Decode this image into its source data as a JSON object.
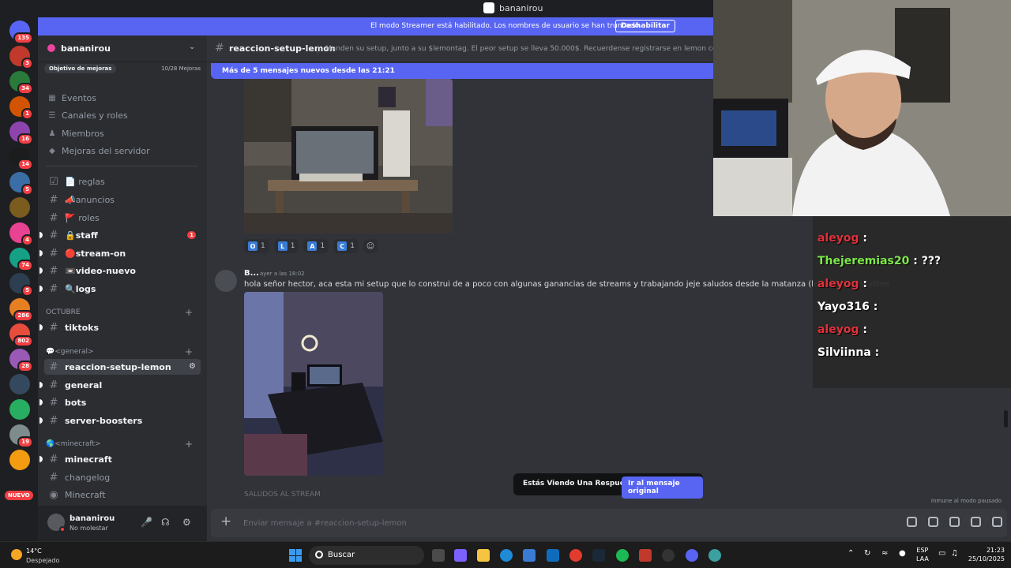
{
  "window": {
    "title": "bananirou"
  },
  "streamer_banner": {
    "text": "El modo Streamer está habilitado. Los nombres de usuario se han truncado.",
    "button": "Deshabilitar"
  },
  "servers": [
    {
      "badge": "135"
    },
    {
      "badge": "3"
    },
    {
      "badge": "34"
    },
    {
      "badge": "1"
    },
    {
      "badge": "16"
    },
    {
      "badge": "14"
    },
    {
      "badge": "5"
    },
    {
      "badge": ""
    },
    {
      "badge": "4"
    },
    {
      "badge": "74"
    },
    {
      "badge": "5"
    },
    {
      "badge": "286"
    },
    {
      "badge": "802"
    },
    {
      "badge": "28"
    },
    {
      "badge": ""
    },
    {
      "badge": ""
    },
    {
      "badge": "19"
    },
    {
      "badge": ""
    }
  ],
  "server_new_badge": "NUEVO",
  "guild": {
    "name": "bananirou",
    "boost_goal": "Objetivo de mejoras",
    "boost_count": "10/28 Mejoras",
    "nav": [
      {
        "label": "Eventos",
        "icon": "calendar-icon"
      },
      {
        "label": "Canales y roles",
        "icon": "channels-icon"
      },
      {
        "label": "Miembros",
        "icon": "members-icon"
      },
      {
        "label": "Mejoras del servidor",
        "icon": "boost-icon"
      }
    ],
    "channels_top": [
      {
        "name": "📄 reglas",
        "unread": false,
        "mention": ""
      },
      {
        "name": "📣anuncios",
        "unread": false,
        "mention": ""
      },
      {
        "name": "🚩 roles",
        "unread": false,
        "mention": ""
      },
      {
        "name": "🔒staff",
        "unread": true,
        "mention": "1"
      },
      {
        "name": "🔴stream-on",
        "unread": true,
        "mention": ""
      },
      {
        "name": "📼video-nuevo",
        "unread": true,
        "mention": ""
      },
      {
        "name": "🔍logs",
        "unread": true,
        "mention": ""
      }
    ],
    "categories": [
      {
        "name": "OCTUBRE",
        "channels": [
          {
            "name": "tiktoks",
            "unread": true
          }
        ]
      },
      {
        "name": "💬<general>",
        "channels": [
          {
            "name": "reaccion-setup-lemon",
            "unread": true,
            "active": true
          },
          {
            "name": "general",
            "unread": true
          },
          {
            "name": "bots",
            "unread": true
          },
          {
            "name": "server-boosters",
            "unread": true
          }
        ]
      },
      {
        "name": "🌎<minecraft>",
        "channels": [
          {
            "name": "minecraft",
            "unread": true
          },
          {
            "name": "changelog",
            "unread": false
          },
          {
            "name": "Minecraft",
            "unread": false
          }
        ]
      }
    ]
  },
  "user": {
    "name": "bananirou",
    "status": "No molestar"
  },
  "chat": {
    "channel": "reaccion-setup-lemon",
    "topic": "Manden su setup, junto a su $lemontag. El peor setup se lleva 50.000$. Recuerdense registrarse en lemon con codigo #ban",
    "new_messages": "Más de 5 mensajes nuevos desde las 21:21",
    "reactions": [
      {
        "emoji": "O",
        "count": "1"
      },
      {
        "emoji": "L",
        "count": "1"
      },
      {
        "emoji": "A",
        "count": "1"
      },
      {
        "emoji": "C",
        "count": "1"
      }
    ],
    "message": {
      "author": "B...",
      "time": "ayer a las 18:02",
      "text": "hola señor hector, aca esta mi setup que lo construi de a poco con algunas ganancias de streams y trabajando jeje saludos desde la matanza (lemontag: $soyblee"
    },
    "reply_preview": "SALUDOS AL STREAM",
    "reply_toast": {
      "text": "Estás Viendo Una Respuesta.",
      "button": "Ir al mensaje original"
    },
    "paused": "Inmune al modo pausado",
    "composer_placeholder": "Enviar mensaje a #reaccion-setup-lemon"
  },
  "stream_chat": [
    {
      "user": "aleyog",
      "text": ":",
      "color": "#e0323c"
    },
    {
      "user": "Thejeremias20",
      "text": ": ???",
      "color": "#7ee84b"
    },
    {
      "user": "aleyog",
      "text": ":",
      "color": "#e0323c"
    },
    {
      "user": "Yayo316",
      "text": ":",
      "color": "#ffffff"
    },
    {
      "user": "aleyog",
      "text": ":",
      "color": "#e0323c"
    },
    {
      "user": "Silviinna",
      "text": ":",
      "color": "#ffffff"
    }
  ],
  "taskbar": {
    "weather_temp": "14°C",
    "weather_cond": "Despejado",
    "search": "Buscar",
    "lang1": "ESP",
    "lang2": "LAA",
    "time": "21:23",
    "date": "25/10/2025"
  }
}
